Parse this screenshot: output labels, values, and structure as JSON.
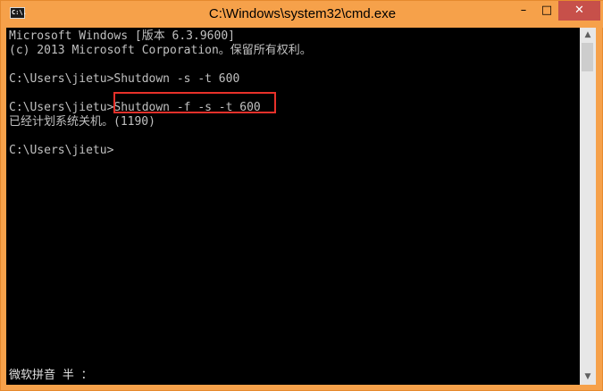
{
  "window": {
    "title": "C:\\Windows\\system32\\cmd.exe",
    "icon_text": "C:\\."
  },
  "controls": {
    "minimize": "–",
    "maximize": "□",
    "close": "✕"
  },
  "console": {
    "lines": [
      "Microsoft Windows [版本 6.3.9600]",
      "(c) 2013 Microsoft Corporation。保留所有权利。",
      "",
      "C:\\Users\\jietu>Shutdown -s -t 600",
      "",
      "C:\\Users\\jietu>Shutdown -f -s -t 600",
      "已经计划系统关机。(1190)",
      "",
      "C:\\Users\\jietu>"
    ],
    "ime_status": "微软拼音 半 ："
  },
  "scrollbar": {
    "up": "▲",
    "down": "▼"
  },
  "colors": {
    "frame": "#f6a14a",
    "console_bg": "#000000",
    "console_text": "#c0c0c0",
    "highlight": "#e8312a",
    "close_button": "#c7504a"
  }
}
